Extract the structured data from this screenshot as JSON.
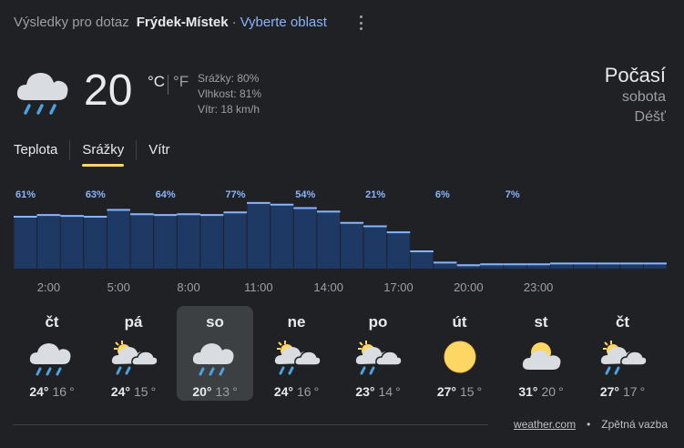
{
  "header": {
    "prefix": "Výsledky pro dotaz",
    "location": "Frýdek-Místek",
    "separator": "·",
    "choose_area": "Vyberte oblast"
  },
  "current": {
    "icon": "rain-cloud-icon",
    "temp": "20",
    "unit_c": "°C",
    "unit_f": "°F",
    "precip": "Srážky: 80%",
    "humidity": "Vlhkost: 81%",
    "wind": "Vítr: 18 km/h"
  },
  "summary": {
    "title": "Počasí",
    "day": "sobota",
    "condition": "Déšť"
  },
  "tabs": [
    {
      "label": "Teplota",
      "active": false
    },
    {
      "label": "Srážky",
      "active": true
    },
    {
      "label": "Vítr",
      "active": false
    }
  ],
  "chart_data": {
    "type": "bar",
    "values": [
      61,
      63,
      62,
      61,
      69,
      64,
      63,
      64,
      63,
      66,
      77,
      75,
      71,
      67,
      54,
      50,
      43,
      21,
      8,
      5,
      6,
      6,
      6,
      7,
      7,
      7,
      7,
      7
    ],
    "value_labels": [
      "61%",
      "63%",
      "64%",
      "77%",
      "54%",
      "21%",
      "6%",
      "7%"
    ],
    "tick_labels": [
      "2:00",
      "5:00",
      "8:00",
      "11:00",
      "14:00",
      "17:00",
      "20:00",
      "23:00"
    ],
    "ylim": [
      0,
      100
    ],
    "bar_color": "#1f3965",
    "edge_color": "#8ab4f8",
    "label_color": "#8ab4f8"
  },
  "days": [
    {
      "name": "čt",
      "icon": "rain-cloud-icon",
      "hi": "24",
      "lo": "16",
      "deg": "°"
    },
    {
      "name": "pá",
      "icon": "sun-cloud-rain-icon",
      "hi": "24",
      "lo": "15",
      "deg": "°"
    },
    {
      "name": "so",
      "icon": "rain-cloud-icon",
      "hi": "20",
      "lo": "13",
      "deg": "°"
    },
    {
      "name": "ne",
      "icon": "sun-cloud-rain-icon",
      "hi": "24",
      "lo": "16",
      "deg": "°"
    },
    {
      "name": "po",
      "icon": "sun-cloud-rain-icon",
      "hi": "23",
      "lo": "14",
      "deg": "°"
    },
    {
      "name": "út",
      "icon": "sun-icon",
      "hi": "27",
      "lo": "15",
      "deg": "°"
    },
    {
      "name": "st",
      "icon": "partly-cloudy-icon",
      "hi": "31",
      "lo": "20",
      "deg": "°"
    },
    {
      "name": "čt",
      "icon": "sun-cloud-rain-icon",
      "hi": "27",
      "lo": "17",
      "deg": "°"
    }
  ],
  "selected_day_index": 2,
  "footer": {
    "source": "weather.com",
    "bullet": "•",
    "feedback": "Zpětná vazba"
  },
  "colors": {
    "background": "#202124",
    "accent": "#fdd663",
    "link": "#8ab4f8"
  }
}
